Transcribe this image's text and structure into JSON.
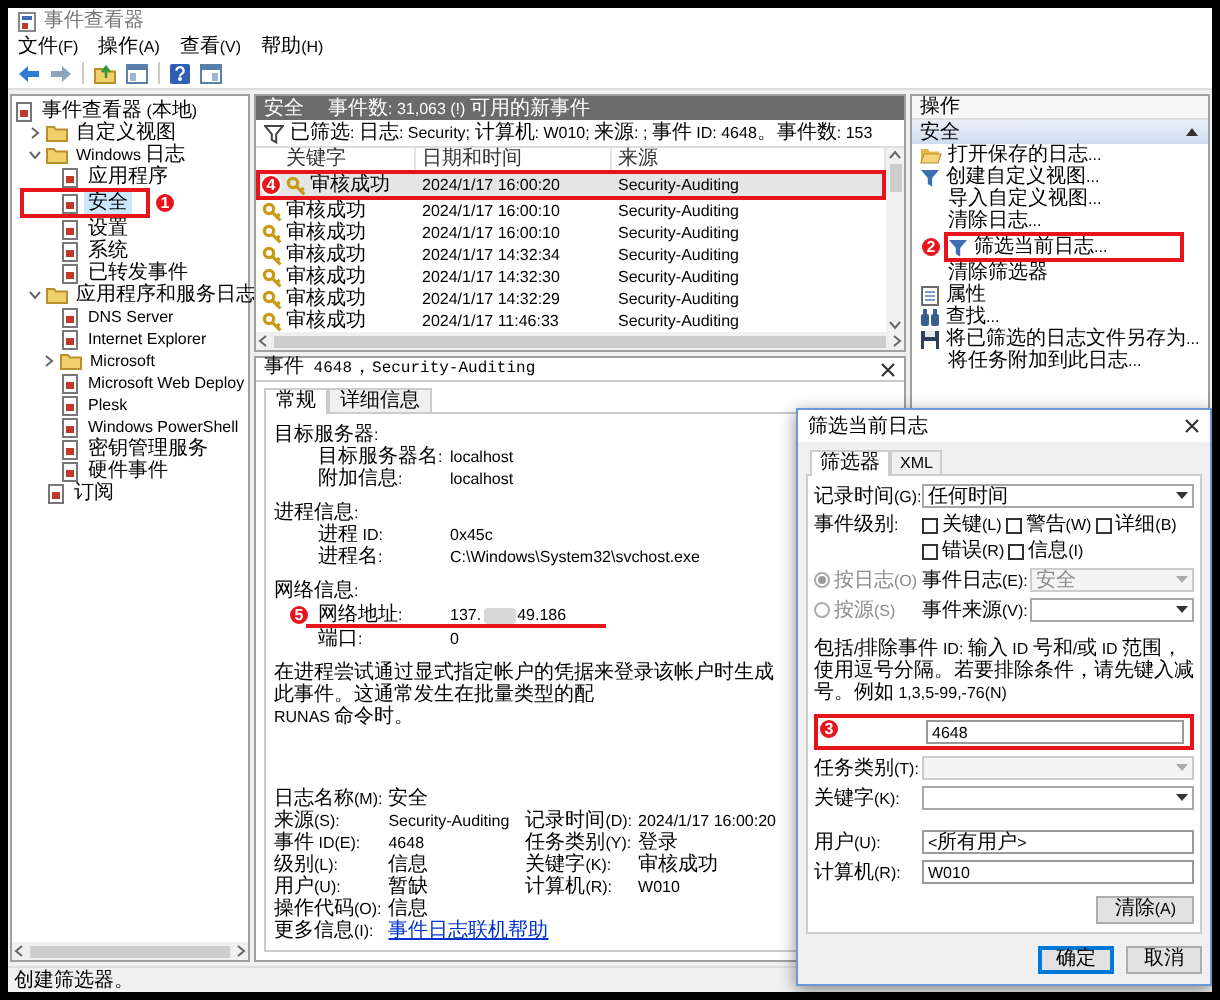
{
  "window": {
    "title": "事件查看器"
  },
  "menu": [
    "文件(F)",
    "操作(A)",
    "查看(V)",
    "帮助(H)"
  ],
  "tree": [
    {
      "label": "事件查看器 (本地)",
      "selected": false,
      "children": [
        {
          "label": "自定义视图",
          "selected": false,
          "expanded": false
        },
        {
          "label": "Windows 日志",
          "selected": false,
          "expanded": true,
          "children": [
            {
              "label": "应用程序",
              "selected": false
            },
            {
              "label": "安全",
              "selected": true,
              "callout": "1"
            },
            {
              "label": "设置",
              "selected": false
            },
            {
              "label": "系统",
              "selected": false
            },
            {
              "label": "已转发事件",
              "selected": false
            }
          ]
        },
        {
          "label": "应用程序和服务日志",
          "selected": false,
          "expanded": true,
          "children": [
            {
              "label": "DNS Server",
              "selected": false
            },
            {
              "label": "Internet Explorer",
              "selected": false
            },
            {
              "label": "Microsoft",
              "selected": false,
              "expanded": false
            },
            {
              "label": "Microsoft Web Deploy",
              "selected": false
            },
            {
              "label": "Plesk",
              "selected": false
            },
            {
              "label": "Windows PowerShell",
              "selected": false
            },
            {
              "label": "密钥管理服务",
              "selected": false
            },
            {
              "label": "硬件事件",
              "selected": false
            }
          ]
        },
        {
          "label": "订阅",
          "selected": false
        }
      ]
    }
  ],
  "events": {
    "log_name": "安全",
    "count_text": "事件数: 31,063 (!) 可用的新事件",
    "filter_text": "已筛选: 日志: Security; 计算机: W010; 来源: ; 事件 ID: 4648。事件数: 153",
    "columns": [
      "关键字",
      "日期和时间",
      "来源"
    ],
    "rows": [
      {
        "keyword": "审核成功",
        "time": "2024/1/17 16:00:20",
        "source": "Security-Auditing",
        "selected": true,
        "callout": "4"
      },
      {
        "keyword": "审核成功",
        "time": "2024/1/17 16:00:10",
        "source": "Security-Auditing",
        "selected": false
      },
      {
        "keyword": "审核成功",
        "time": "2024/1/17 16:00:10",
        "source": "Security-Auditing",
        "selected": false
      },
      {
        "keyword": "审核成功",
        "time": "2024/1/17 14:32:34",
        "source": "Security-Auditing",
        "selected": false
      },
      {
        "keyword": "审核成功",
        "time": "2024/1/17 14:32:30",
        "source": "Security-Auditing",
        "selected": false
      },
      {
        "keyword": "审核成功",
        "time": "2024/1/17 14:32:29",
        "source": "Security-Auditing",
        "selected": false
      },
      {
        "keyword": "审核成功",
        "time": "2024/1/17 11:46:33",
        "source": "Security-Auditing",
        "selected": false
      }
    ]
  },
  "detail": {
    "title": "事件 4648，Security-Auditing",
    "tabs": [
      {
        "label": "常规",
        "selected": true
      },
      {
        "label": "详细信息",
        "selected": false
      }
    ],
    "sections": [
      {
        "heading": "目标服务器:",
        "fields": [
          {
            "label": "目标服务器名:",
            "value": "localhost"
          },
          {
            "label": "附加信息:",
            "value": "localhost"
          }
        ]
      },
      {
        "heading": "进程信息:",
        "fields": [
          {
            "label": "进程 ID:",
            "value": "0x45c"
          },
          {
            "label": "进程名:",
            "value": "C:\\Windows\\System32\\svchost.exe"
          }
        ]
      },
      {
        "heading": "网络信息:",
        "fields": [
          {
            "label": "网络地址:",
            "value": "137.",
            "redacted": true,
            "value_after": "49.186",
            "callout": "5"
          },
          {
            "label": "端口:",
            "value": "0"
          }
        ]
      }
    ],
    "message": [
      "在进程尝试通过显式指定帐户的凭据来登录该帐户时生成此事件。这通常发生在批量类型的配",
      "RUNAS 命令时。"
    ],
    "properties": [
      {
        "label": "日志名称(M):",
        "value": "安全"
      },
      {
        "label": "来源(S):",
        "value": "Security-Auditing",
        "label2": "记录时间(D):",
        "value2": "2024/1/17 16:00:20"
      },
      {
        "label": "事件 ID(E):",
        "value": "4648",
        "label2": "任务类别(Y):",
        "value2": "登录"
      },
      {
        "label": "级别(L):",
        "value": "信息",
        "label2": "关键字(K):",
        "value2": "审核成功"
      },
      {
        "label": "用户(U):",
        "value": "暂缺",
        "label2": "计算机(R):",
        "value2": "W010"
      },
      {
        "label": "操作代码(O):",
        "value": "信息"
      }
    ],
    "more_info": {
      "label": "更多信息(I):",
      "link": "事件日志联机帮助"
    }
  },
  "actions": {
    "title": "操作",
    "section": {
      "label": "安全",
      "expanded": true
    },
    "items": [
      {
        "label": "打开保存的日志..."
      },
      {
        "label": "创建自定义视图..."
      },
      {
        "label": "导入自定义视图..."
      },
      {
        "label": "清除日志..."
      },
      {
        "label": "筛选当前日志...",
        "callout": "2"
      },
      {
        "label": "清除筛选器"
      },
      {
        "label": "属性"
      },
      {
        "label": "查找..."
      },
      {
        "label": "将已筛选的日志文件另存为..."
      },
      {
        "label": "将任务附加到此日志..."
      }
    ]
  },
  "dialog": {
    "title": "筛选当前日志",
    "tabs": [
      {
        "label": "筛选器",
        "selected": true
      },
      {
        "label": "XML",
        "selected": false
      }
    ],
    "logged": {
      "label": "记录时间(G):",
      "value": "任何时间",
      "disabled": false
    },
    "level_label": "事件级别:",
    "levels": [
      {
        "label": "关键(L)",
        "checked": false
      },
      {
        "label": "警告(W)",
        "checked": false
      },
      {
        "label": "详细(B)",
        "checked": false
      },
      {
        "label": "错误(R)",
        "checked": false
      },
      {
        "label": "信息(I)",
        "checked": false
      }
    ],
    "sources": [
      {
        "label": "按日志(O)",
        "selected": true,
        "disabled": true,
        "field_label": "事件日志(E):",
        "value": "安全",
        "field_disabled": true
      },
      {
        "label": "按源(S)",
        "selected": false,
        "disabled": true,
        "field_label": "事件来源(V):",
        "field_disabled": false
      }
    ],
    "id_help": "包括/排除事件 ID: 输入 ID 号和/或 ID 范围，使用逗号分隔。若要排除条件，请先键入减号。例如 1,3,5-99,-76(N)",
    "event_ids": {
      "value": "4648",
      "callout": "3"
    },
    "task_category": {
      "label": "任务类别(T):",
      "disabled": true
    },
    "keywords": {
      "label": "关键字(K):",
      "disabled": false
    },
    "user": {
      "label": "用户(U):",
      "value": "<所有用户>"
    },
    "computer": {
      "label": "计算机(R):",
      "value": "W010"
    },
    "clear_button": "清除(A)",
    "buttons": [
      {
        "label": "确定",
        "default": true
      },
      {
        "label": "取消",
        "default": false
      }
    ]
  },
  "status_bar": "创建筛选器。"
}
